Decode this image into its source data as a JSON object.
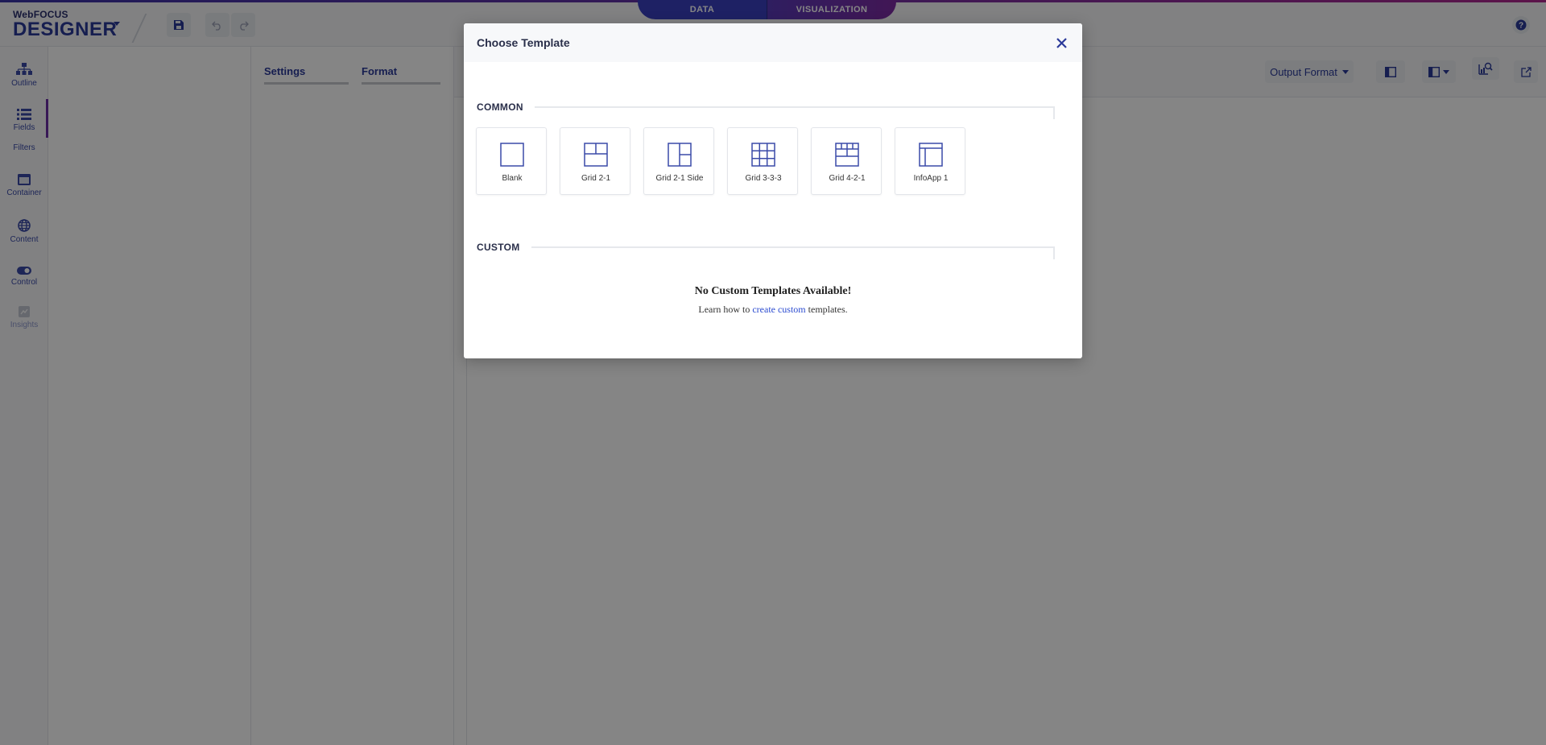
{
  "app": {
    "brand_sub": "WebFOCUS",
    "brand_main": "DESIGNER"
  },
  "toolbar": {
    "save_icon": "save-icon",
    "undo_icon": "undo-icon",
    "redo_icon": "redo-icon",
    "help_icon": "help-icon"
  },
  "modes": {
    "data": "DATA",
    "visualization": "VISUALIZATION"
  },
  "leftnav": {
    "items": [
      {
        "label": "Outline",
        "icon": "outline-icon"
      },
      {
        "label": "Fields",
        "icon": "fields-icon"
      },
      {
        "label": "Filters",
        "icon": ""
      },
      {
        "label": "Container",
        "icon": "container-icon"
      },
      {
        "label": "Content",
        "icon": "content-icon"
      },
      {
        "label": "Control",
        "icon": "toggle-icon"
      },
      {
        "label": "Insights",
        "icon": "insights-icon"
      }
    ]
  },
  "panel": {
    "tab_settings": "Settings",
    "tab_format": "Format"
  },
  "canvas_toolbar": {
    "output_format": "Output Format"
  },
  "modal": {
    "title": "Choose Template",
    "common_label": "COMMON",
    "custom_label": "CUSTOM",
    "templates": [
      {
        "label": "Blank",
        "icon": "blank-template-icon"
      },
      {
        "label": "Grid 2-1",
        "icon": "grid-2-1-template-icon"
      },
      {
        "label": "Grid 2-1 Side",
        "icon": "grid-2-1-side-template-icon"
      },
      {
        "label": "Grid 3-3-3",
        "icon": "grid-3-3-3-template-icon"
      },
      {
        "label": "Grid 4-2-1",
        "icon": "grid-4-2-1-template-icon"
      },
      {
        "label": "InfoApp 1",
        "icon": "infoapp-1-template-icon"
      }
    ],
    "empty_title": "No Custom Templates Available!",
    "empty_text_before": "Learn how to ",
    "empty_link": "create custom",
    "empty_text_after": " templates."
  },
  "colors": {
    "accent": "#2b3a9a",
    "link": "#2b4bd0",
    "overlay": "rgba(0,0,0,0.48)"
  }
}
